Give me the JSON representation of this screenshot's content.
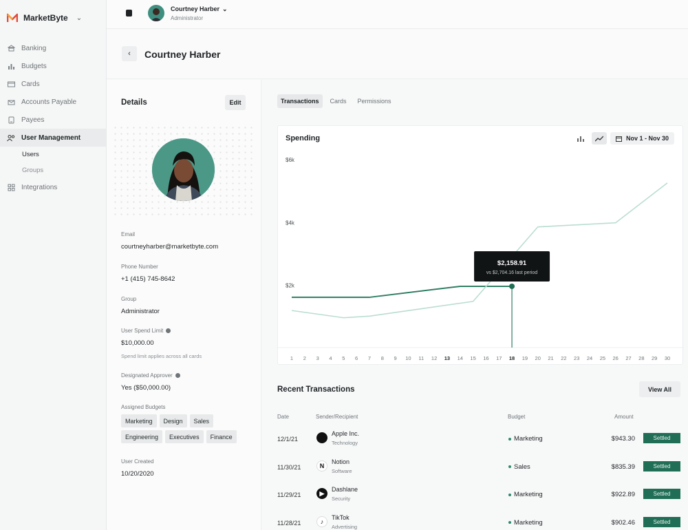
{
  "brand": {
    "name": "MarketByte"
  },
  "sidebar": {
    "items": [
      {
        "label": "Banking",
        "icon": "bank-icon"
      },
      {
        "label": "Budgets",
        "icon": "bar-chart-icon"
      },
      {
        "label": "Cards",
        "icon": "card-icon"
      },
      {
        "label": "Accounts Payable",
        "icon": "invoice-icon"
      },
      {
        "label": "Payees",
        "icon": "payee-icon"
      },
      {
        "label": "User Management",
        "icon": "users-icon"
      }
    ],
    "sub_items": [
      "Users",
      "Groups"
    ],
    "integrations": {
      "label": "Integrations",
      "icon": "grid-icon"
    }
  },
  "topbar": {
    "user_name": "Courtney Harber",
    "user_role": "Administrator"
  },
  "page": {
    "title": "Courtney Harber"
  },
  "details": {
    "title": "Details",
    "edit_label": "Edit",
    "email_label": "Email",
    "email": "courtneyharber@marketbyte.com",
    "phone_label": "Phone Number",
    "phone": "+1 (415) 745-8642",
    "group_label": "Group",
    "group": "Administrator",
    "spend_label": "User Spend Limit",
    "spend": "$10,000.00",
    "spend_note": "Spend limit applies across all cards",
    "approver_label": "Designated Approver",
    "approver": "Yes ($50,000.00)",
    "budgets_label": "Assigned Budgets",
    "budgets": [
      "Marketing",
      "Design",
      "Sales",
      "Engineering",
      "Executives",
      "Finance"
    ],
    "created_label": "User Created",
    "created": "10/20/2020"
  },
  "tabs": [
    "Transactions",
    "Cards",
    "Permissions"
  ],
  "chart": {
    "title": "Spending",
    "date_range": "Nov 1 - Nov 30"
  },
  "chart_data": {
    "type": "line",
    "title": "Spending",
    "x": [
      1,
      2,
      3,
      4,
      5,
      6,
      7,
      8,
      9,
      10,
      11,
      12,
      13,
      14,
      15,
      16,
      17,
      18,
      19,
      20,
      21,
      22,
      23,
      24,
      25,
      26,
      27,
      28,
      29,
      30
    ],
    "y_ticks": [
      "$2k",
      "$4k",
      "$6k"
    ],
    "ylim": [
      0,
      6000
    ],
    "series": [
      {
        "points": [
          [
            1,
            1600
          ],
          [
            5,
            1600
          ],
          [
            7,
            1600
          ],
          [
            14,
            1950
          ],
          [
            18,
            1950
          ]
        ],
        "color": "#2f7d63"
      },
      {
        "points": [
          [
            1,
            1180
          ],
          [
            5,
            950
          ],
          [
            7,
            1000
          ],
          [
            15,
            1470
          ],
          [
            20,
            3840
          ],
          [
            26,
            3970
          ],
          [
            30,
            5240
          ]
        ],
        "color": "#b9ddd1"
      }
    ],
    "tooltip": {
      "x": 18,
      "value": "$2,158.91",
      "compare": "vs $2,704.16 last period"
    },
    "bold_ticks": [
      13,
      18
    ]
  },
  "recent": {
    "title": "Recent Transactions",
    "view_all": "View All",
    "headers": {
      "date": "Date",
      "sender": "Sender/Recipient",
      "budget": "Budget",
      "amount": "Amount"
    },
    "rows": [
      {
        "date": "12/1/21",
        "merchant": "Apple Inc.",
        "category": "Technology",
        "budget": "Marketing",
        "amount": "$943.30",
        "status": "Settled",
        "logo": "apple-logo-icon",
        "logo_char": "",
        "logo_bg": "#111111"
      },
      {
        "date": "11/30/21",
        "merchant": "Notion",
        "category": "Software",
        "budget": "Sales",
        "amount": "$835.39",
        "status": "Settled",
        "logo": "notion-logo-icon",
        "logo_char": "N",
        "logo_bg": "#ffffff"
      },
      {
        "date": "11/29/21",
        "merchant": "Dashlane",
        "category": "Security",
        "budget": "Marketing",
        "amount": "$922.89",
        "status": "Settled",
        "logo": "dashlane-logo-icon",
        "logo_char": "▶",
        "logo_bg": "#111111"
      },
      {
        "date": "11/28/21",
        "merchant": "TikTok",
        "category": "Advertising",
        "budget": "Marketing",
        "amount": "$902.46",
        "status": "Settled",
        "logo": "tiktok-logo-icon",
        "logo_char": "♪",
        "logo_bg": "#ffffff"
      }
    ]
  }
}
